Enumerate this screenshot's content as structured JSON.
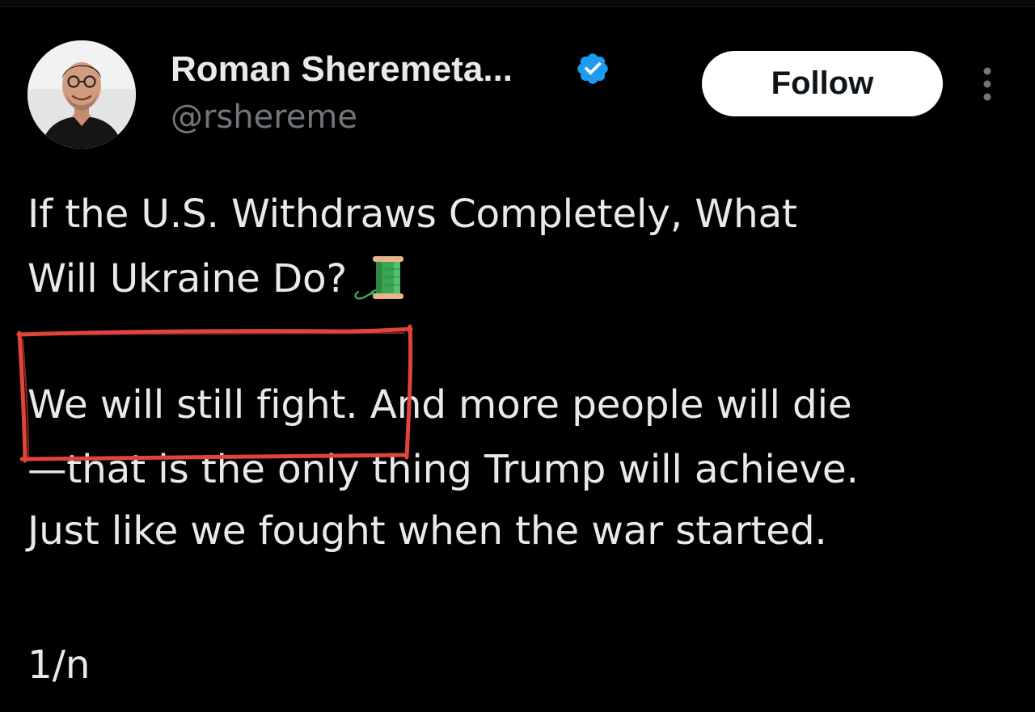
{
  "tweet": {
    "author": {
      "display_name": "Roman Sheremeta...",
      "handle": "@rshereme",
      "verified": true
    },
    "follow_label": "Follow",
    "lines": [
      "If the U.S. Withdraws Completely, What",
      "Will Ukraine Do?",
      "We will still fight. And more people will die",
      "—that is the only thing Trump will achieve.",
      "Just like we fought when the war started.",
      "1/n"
    ],
    "inline_emoji": "spool-of-thread-icon"
  },
  "colors": {
    "background": "#000000",
    "text_primary": "#e7e9ea",
    "text_secondary": "#71767b",
    "verified_badge": "#1d9bf0",
    "follow_button_bg": "#ffffff",
    "annotation_red": "#e0443a"
  },
  "annotation": {
    "type": "hand-drawn-rectangle",
    "highlights": "We will still fight."
  }
}
